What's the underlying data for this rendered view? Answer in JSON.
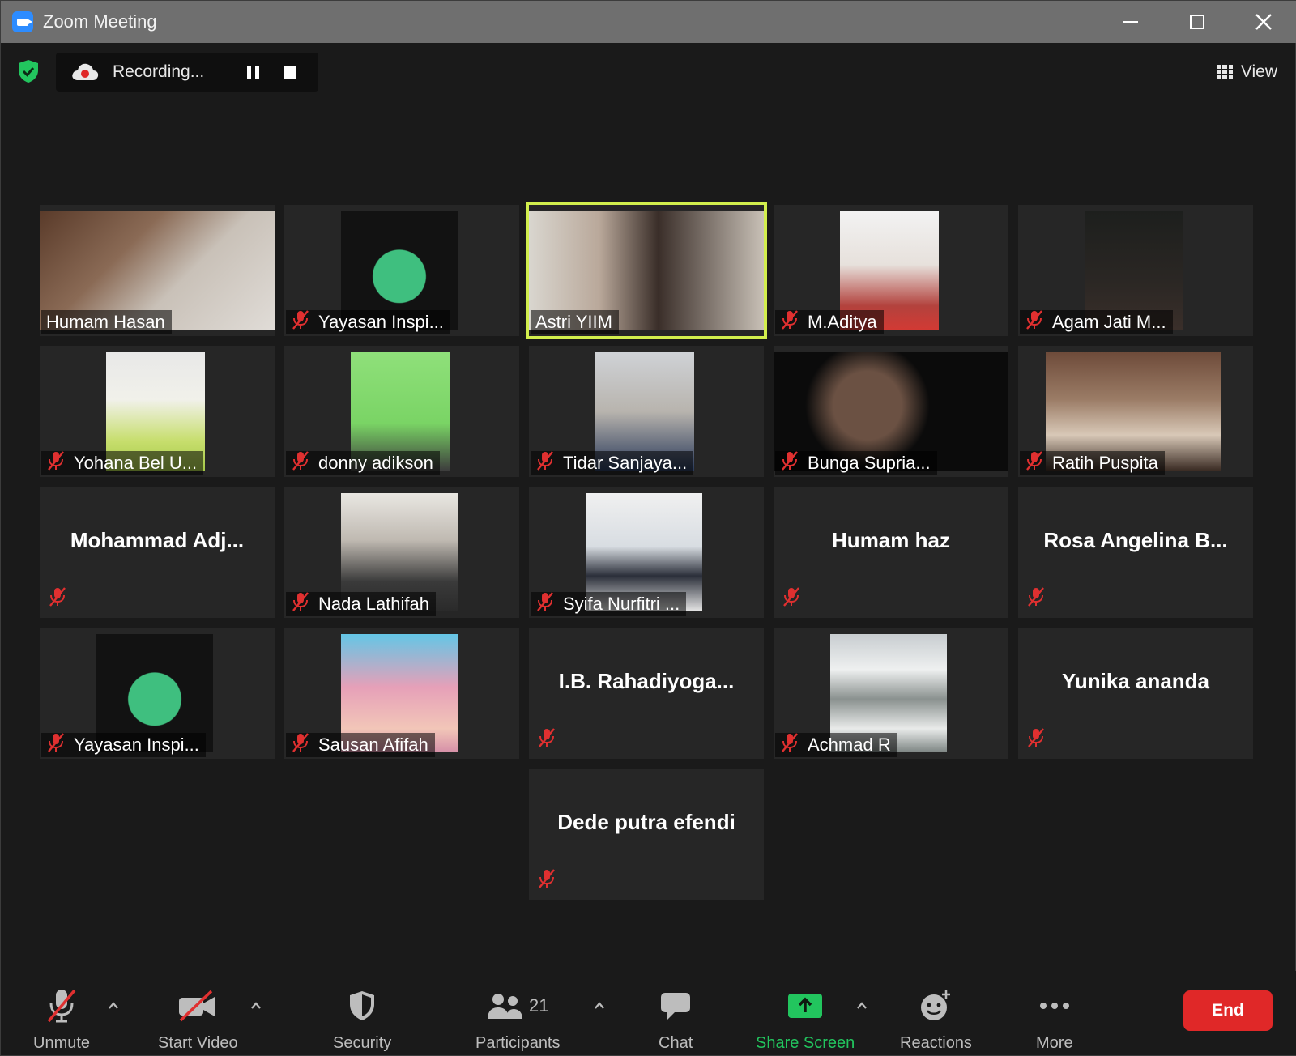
{
  "window": {
    "title": "Zoom Meeting"
  },
  "topbar": {
    "recording_label": "Recording...",
    "view_label": "View"
  },
  "participants": [
    {
      "name": "Humam Hasan",
      "video": true,
      "muted": false,
      "active": false
    },
    {
      "name": "Yayasan Inspi...",
      "video": true,
      "muted": true,
      "active": false
    },
    {
      "name": "Astri YIIM",
      "video": true,
      "muted": false,
      "active": true
    },
    {
      "name": "M.Aditya",
      "video": true,
      "muted": true,
      "active": false
    },
    {
      "name": "Agam Jati M...",
      "video": true,
      "muted": true,
      "active": false
    },
    {
      "name": "Yohana Bel U...",
      "video": true,
      "muted": true,
      "active": false
    },
    {
      "name": "donny adikson",
      "video": true,
      "muted": true,
      "active": false
    },
    {
      "name": "Tidar Sanjaya...",
      "video": true,
      "muted": true,
      "active": false
    },
    {
      "name": "Bunga Supria...",
      "video": true,
      "muted": true,
      "active": false
    },
    {
      "name": "Ratih Puspita",
      "video": true,
      "muted": true,
      "active": false
    },
    {
      "name": "Mohammad Adj...",
      "video": false,
      "muted": true,
      "active": false
    },
    {
      "name": "Nada Lathifah",
      "video": true,
      "muted": true,
      "active": false
    },
    {
      "name": "Syifa Nurfitri ...",
      "video": true,
      "muted": true,
      "active": false
    },
    {
      "name": "Humam haz",
      "video": false,
      "muted": true,
      "active": false
    },
    {
      "name": "Rosa Angelina B...",
      "video": false,
      "muted": true,
      "active": false
    },
    {
      "name": "Yayasan Inspi...",
      "video": true,
      "muted": true,
      "active": false
    },
    {
      "name": "Sausan Afifah",
      "video": true,
      "muted": true,
      "active": false
    },
    {
      "name": "I.B. Rahadiyoga...",
      "video": false,
      "muted": true,
      "active": false
    },
    {
      "name": "Achmad R",
      "video": true,
      "muted": true,
      "active": false
    },
    {
      "name": "Yunika ananda",
      "video": false,
      "muted": true,
      "active": false
    },
    {
      "name": "Dede putra efendi",
      "video": false,
      "muted": true,
      "active": false
    }
  ],
  "toolbar": {
    "unmute": "Unmute",
    "start_video": "Start Video",
    "security": "Security",
    "participants": "Participants",
    "participants_count": "21",
    "chat": "Chat",
    "share_screen": "Share Screen",
    "reactions": "Reactions",
    "more": "More",
    "end": "End"
  },
  "colors": {
    "accent_active": "#d2ef4d",
    "end_red": "#e02828",
    "share_green": "#22c55e",
    "mute_red": "#e03030",
    "security_green": "#22c55e"
  }
}
